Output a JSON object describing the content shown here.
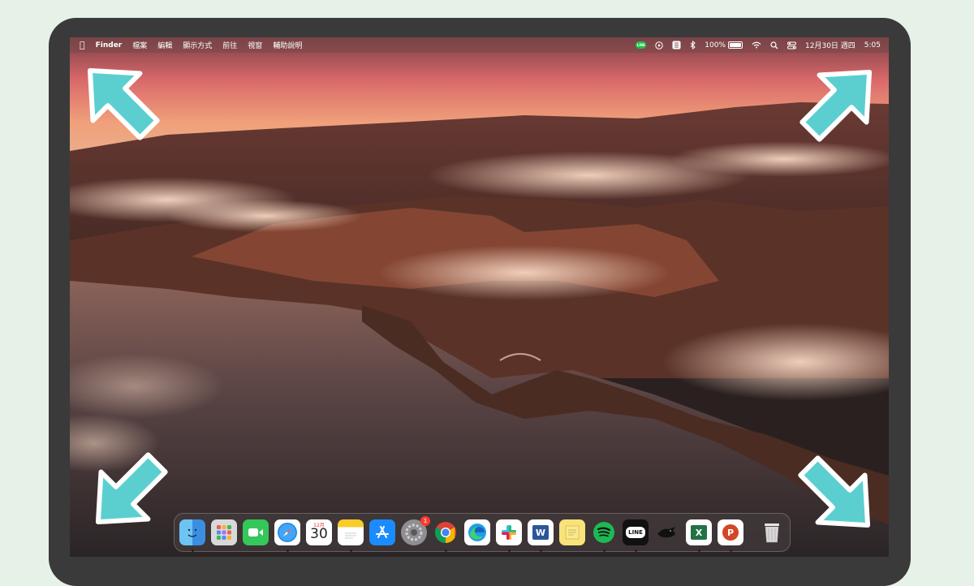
{
  "menubar": {
    "apple_icon": "apple-icon",
    "app_name": "Finder",
    "menus": [
      "檔案",
      "編輯",
      "顯示方式",
      "前往",
      "視窗",
      "輔助說明"
    ],
    "status": {
      "line_label": "LINE",
      "battery_percent": "100%",
      "battery_level": 1.0,
      "date": "12月30日 週四",
      "time": "5:05"
    }
  },
  "arrows": {
    "color": "#5bcfd0",
    "outline": "#ffffff"
  },
  "dock": {
    "calendar": {
      "month": "12月",
      "day": "30"
    },
    "settings_badge": "1",
    "excel_letter": "X",
    "word_letter": "W",
    "powerpoint_letter": "P",
    "line_text": "LINE",
    "items": [
      "finder-icon",
      "launchpad-icon",
      "facetime-icon",
      "safari-icon",
      "calendar-icon",
      "notes-icon",
      "app-store-icon",
      "system-preferences-icon",
      "chrome-icon",
      "edge-icon",
      "slack-icon",
      "word-icon",
      "stickies-icon",
      "spotify-icon",
      "line-icon",
      "bird-app-icon",
      "excel-icon",
      "powerpoint-icon",
      "trash-icon"
    ]
  }
}
